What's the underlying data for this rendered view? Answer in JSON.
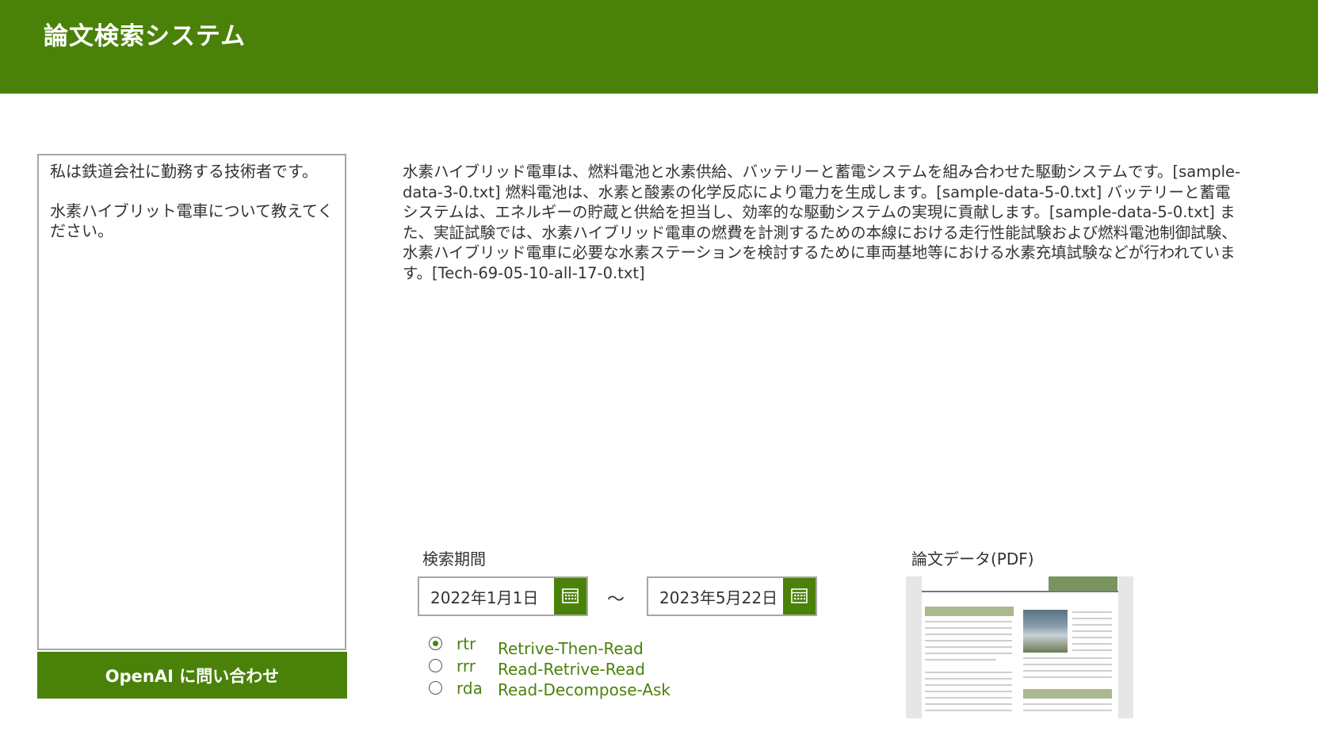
{
  "header": {
    "title": "論文検索システム"
  },
  "prompt": {
    "value": "私は鉄道会社に勤務する技術者です。\n\n水素ハイブリット電車について教えてください。"
  },
  "ask_button": {
    "label": "OpenAI に問い合わせ"
  },
  "answer": {
    "text": "水素ハイブリッド電車は、燃料電池と水素供給、バッテリーと蓄電システムを組み合わせた駆動システムです。[sample-data-3-0.txt] 燃料電池は、水素と酸素の化学反応により電力を生成します。[sample-data-5-0.txt] バッテリーと蓄電システムは、エネルギーの貯蔵と供給を担当し、効率的な駆動システムの実現に貢献します。[sample-data-5-0.txt] また、実証試験では、水素ハイブリッド電車の燃費を計測するための本線における走行性能試験および燃料電池制御試験、水素ハイブリッド電車に必要な水素ステーションを検討するために車両基地等における水素充填試験などが行われています。[Tech-69-05-10-all-17-0.txt]"
  },
  "search_period": {
    "label": "検索期間",
    "start_date": "2022年1月1日",
    "end_date": "2023年5月22日",
    "separator": "～",
    "calendar_icon": "calendar-icon"
  },
  "modes": {
    "selected": "rtr",
    "options": [
      {
        "code": "rtr",
        "description": "Retrive-Then-Read"
      },
      {
        "code": "rrr",
        "description": "Read-Retrive-Read"
      },
      {
        "code": "rda",
        "description": "Read-Decompose-Ask"
      }
    ]
  },
  "pdf": {
    "label": "論文データ(PDF)"
  },
  "colors": {
    "brand": "#4a8209",
    "border": "#a6a6a6",
    "text": "#333333"
  }
}
